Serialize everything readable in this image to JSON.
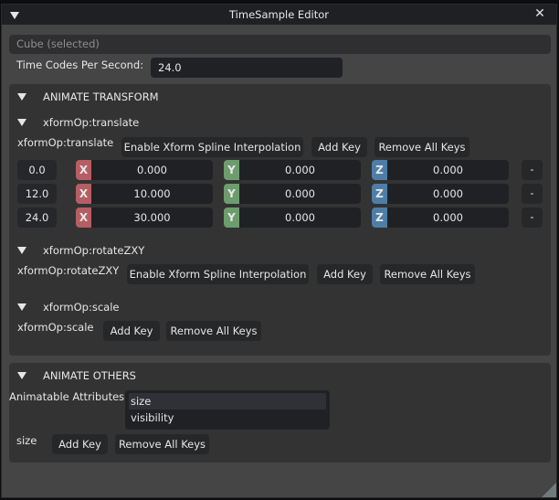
{
  "window": {
    "title": "TimeSample Editor",
    "collapse_icon": "triangle-down-icon",
    "close_icon": "close-icon",
    "close_glyph": "✕"
  },
  "selection": {
    "label": "Cube (selected)"
  },
  "time_codes": {
    "label": "Time Codes Per Second:",
    "value": "24.0"
  },
  "animate_transform": {
    "header": "ANIMATE TRANSFORM",
    "translate": {
      "header": "xformOp:translate",
      "row_label": "xformOp:translate",
      "buttons": {
        "spline": "Enable Xform Spline Interpolation",
        "add_key": "Add Key",
        "remove_all": "Remove All Keys"
      },
      "axis_labels": {
        "x": "X",
        "y": "Y",
        "z": "Z"
      },
      "axis_colors": {
        "x": "#b55e63",
        "y": "#6d9d6d",
        "z": "#4e7ea6"
      },
      "remove_key_label": "-",
      "keys": [
        {
          "time": "0.0",
          "x": "0.000",
          "y": "0.000",
          "z": "0.000"
        },
        {
          "time": "12.0",
          "x": "10.000",
          "y": "0.000",
          "z": "0.000"
        },
        {
          "time": "24.0",
          "x": "30.000",
          "y": "0.000",
          "z": "0.000"
        }
      ]
    },
    "rotate": {
      "header": "xformOp:rotateZXY",
      "row_label": "xformOp:rotateZXY",
      "buttons": {
        "spline": "Enable Xform Spline Interpolation",
        "add_key": "Add Key",
        "remove_all": "Remove All Keys"
      }
    },
    "scale": {
      "header": "xformOp:scale",
      "row_label": "xformOp:scale",
      "buttons": {
        "add_key": "Add Key",
        "remove_all": "Remove All Keys"
      }
    }
  },
  "animate_others": {
    "header": "ANIMATE OTHERS",
    "attributes_label": "Animatable Attributes",
    "attributes": [
      {
        "label": "size",
        "selected": true
      },
      {
        "label": "visibility",
        "selected": false
      }
    ],
    "row_label": "size",
    "buttons": {
      "add_key": "Add Key",
      "remove_all": "Remove All Keys"
    }
  }
}
